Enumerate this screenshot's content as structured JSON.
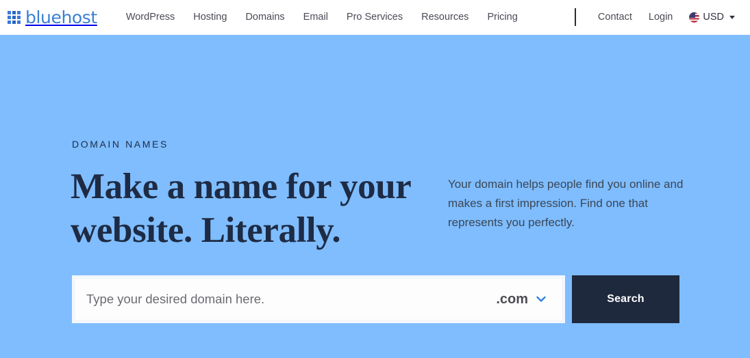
{
  "header": {
    "brand": {
      "name": "bluehost",
      "icon": "grid-3x3-icon"
    },
    "nav": [
      {
        "label": "WordPress"
      },
      {
        "label": "Hosting"
      },
      {
        "label": "Domains"
      },
      {
        "label": "Email"
      },
      {
        "label": "Pro Services"
      },
      {
        "label": "Resources"
      },
      {
        "label": "Pricing"
      }
    ],
    "contact_label": "Contact",
    "login_label": "Login",
    "currency": {
      "code": "USD",
      "flag_icon": "us-flag-icon",
      "caret_icon": "caret-down-icon"
    }
  },
  "hero": {
    "eyebrow": "DOMAIN NAMES",
    "headline": "Make a name for your website. Literally.",
    "lede": "Your domain helps people find you online and makes a first impression. Find one that represents you perfectly.",
    "background_color": "#7fbdff",
    "text_color": "#1e2b44"
  },
  "search": {
    "placeholder": "Type your desired domain here.",
    "value": "",
    "tld": ".com",
    "tld_chevron_icon": "chevron-down-icon",
    "button_label": "Search",
    "button_color": "#1e293d"
  }
}
